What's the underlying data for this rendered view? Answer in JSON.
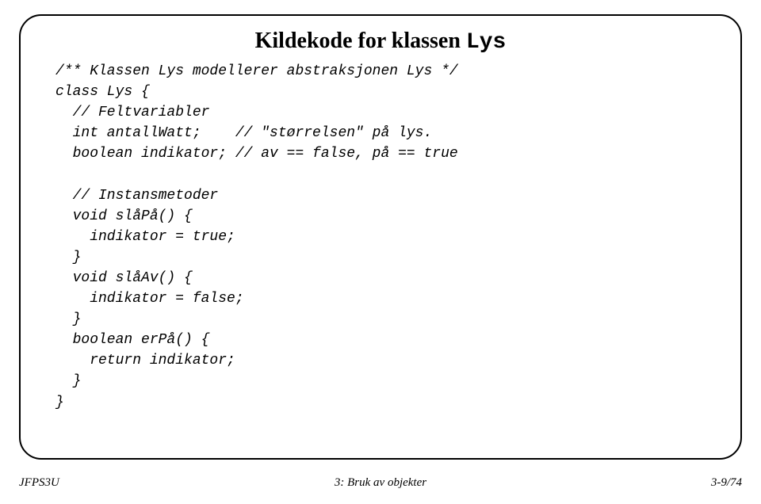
{
  "title_prefix": "Kildekode for klassen ",
  "title_class": "Lys",
  "code": "/** Klassen Lys modellerer abstraksjonen Lys */\nclass Lys {\n  // Feltvariabler\n  int antallWatt;    // \"størrelsen\" på lys.\n  boolean indikator; // av == false, på == true\n\n  // Instansmetoder\n  void slåPå() {\n    indikator = true;\n  }\n  void slåAv() {\n    indikator = false;\n  }\n  boolean erPå() {\n    return indikator;\n  }\n}",
  "footer": {
    "left": "JFPS3U",
    "center": "3: Bruk av objekter",
    "right": "3-9/74"
  }
}
